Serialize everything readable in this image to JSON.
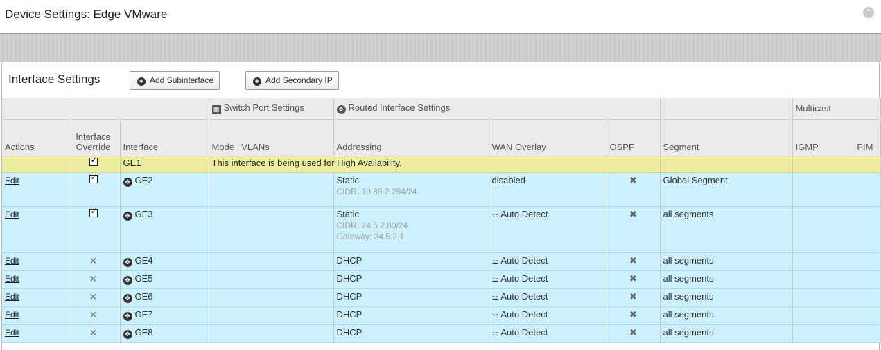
{
  "window": {
    "title": "Device Settings: Edge VMware"
  },
  "panel": {
    "title": "Interface Settings",
    "buttons": {
      "add_subinterface": "Add Subinterface",
      "add_secondary_ip": "Add Secondary IP"
    }
  },
  "table": {
    "groups": {
      "switch_port": "Switch Port Settings",
      "routed": "Routed Interface Settings",
      "multicast": "Multicast"
    },
    "headers": {
      "actions": "Actions",
      "override_line1": "Interface",
      "override_line2": "Override",
      "interface": "Interface",
      "mode": "Mode",
      "vlans": "VLANs",
      "addressing": "Addressing",
      "wan_overlay": "WAN Overlay",
      "ospf": "OSPF",
      "segment": "Segment",
      "igmp": "IGMP",
      "pim": "PIM"
    },
    "ha_row": {
      "interface": "GE1",
      "message": "This interface is being used for High Availability."
    },
    "rows": [
      {
        "action": "Edit",
        "interface": "GE2",
        "addressing": "Static",
        "detail1": "CIDR: 10.89.2.254/24",
        "detail2": "",
        "wan": "disabled",
        "segment": "Global Segment"
      },
      {
        "action": "Edit",
        "interface": "GE3",
        "addressing": "Static",
        "detail1": "CIDR: 24.5.2.80/24",
        "detail2": "Gateway: 24.5.2.1",
        "wan": "Auto Detect",
        "segment": "all segments"
      },
      {
        "action": "Edit",
        "interface": "GE4",
        "addressing": "DHCP",
        "wan": "Auto Detect",
        "segment": "all segments"
      },
      {
        "action": "Edit",
        "interface": "GE5",
        "addressing": "DHCP",
        "wan": "Auto Detect",
        "segment": "all segments"
      },
      {
        "action": "Edit",
        "interface": "GE6",
        "addressing": "DHCP",
        "wan": "Auto Detect",
        "segment": "all segments"
      },
      {
        "action": "Edit",
        "interface": "GE7",
        "addressing": "DHCP",
        "wan": "Auto Detect",
        "segment": "all segments"
      },
      {
        "action": "Edit",
        "interface": "GE8",
        "addressing": "DHCP",
        "wan": "Auto Detect",
        "segment": "all segments"
      }
    ]
  }
}
